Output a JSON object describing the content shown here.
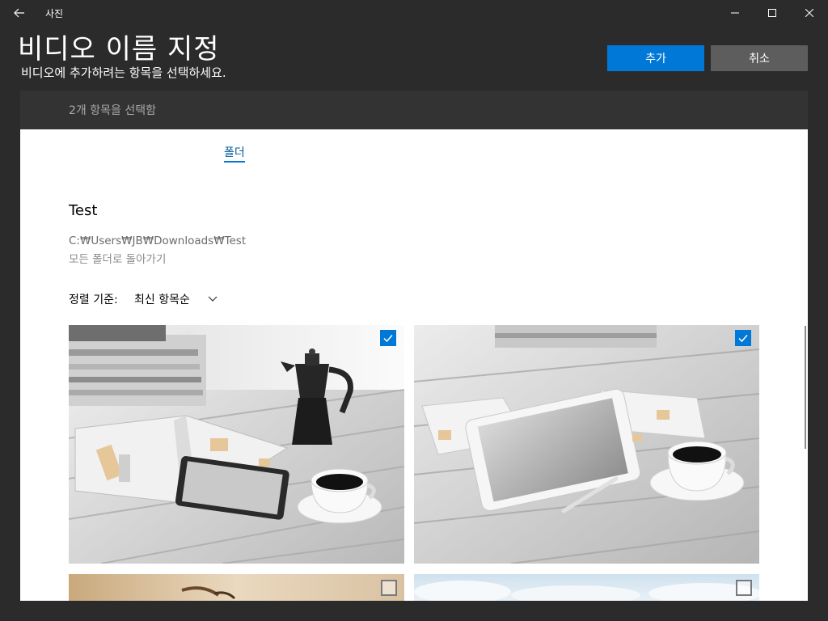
{
  "app": {
    "title": "사진"
  },
  "header": {
    "title": "비디오 이름 지정",
    "subtitle": "비디오에 추가하려는 항목을 선택하세요.",
    "add_label": "추가",
    "cancel_label": "취소"
  },
  "selection": {
    "count_text": "2개 항목을 선택함"
  },
  "folder": {
    "tab_label": "폴더",
    "name": "Test",
    "path": "C:₩Users₩JB₩Downloads₩Test",
    "back_label": "모든 폴더로 돌아가기"
  },
  "sort": {
    "label": "정렬 기준:",
    "value": "최신 항목순"
  },
  "photos": [
    {
      "selected": true
    },
    {
      "selected": true
    },
    {
      "selected": false
    },
    {
      "selected": false
    }
  ],
  "colors": {
    "accent": "#0078d7",
    "titlebar": "#2b2b2b",
    "selbar": "#333333",
    "cancel": "#5d5d5d"
  }
}
